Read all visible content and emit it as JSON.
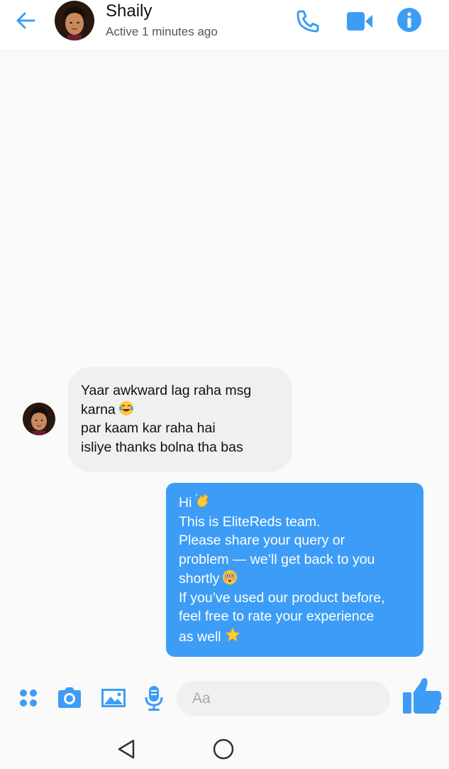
{
  "header": {
    "contact_name": "Shaily",
    "status": "Active 1 minutes ago"
  },
  "messages": [
    {
      "direction": "incoming",
      "lines": [
        "Yaar awkward lag raha msg",
        "karna",
        "par kaam kar raha hai",
        "isliye thanks bolna tha bas"
      ],
      "emoji_after_line": 1,
      "emoji": "laughing-tears"
    },
    {
      "direction": "outgoing",
      "lines": [
        "Hi",
        "This is EliteReds team.",
        "Please share your query or",
        "problem — we’ll get back to you",
        "shortly",
        "If you’ve used our product before,",
        "feel free to rate your experience",
        "as well"
      ],
      "emojis": {
        "0": "waving-hand",
        "4": "flushed-face",
        "7": "star"
      }
    }
  ],
  "composer": {
    "placeholder": "Aa"
  },
  "colors": {
    "accent": "#3d9df6",
    "incoming_bubble": "#f0f0f0",
    "background": "#fafafa"
  }
}
